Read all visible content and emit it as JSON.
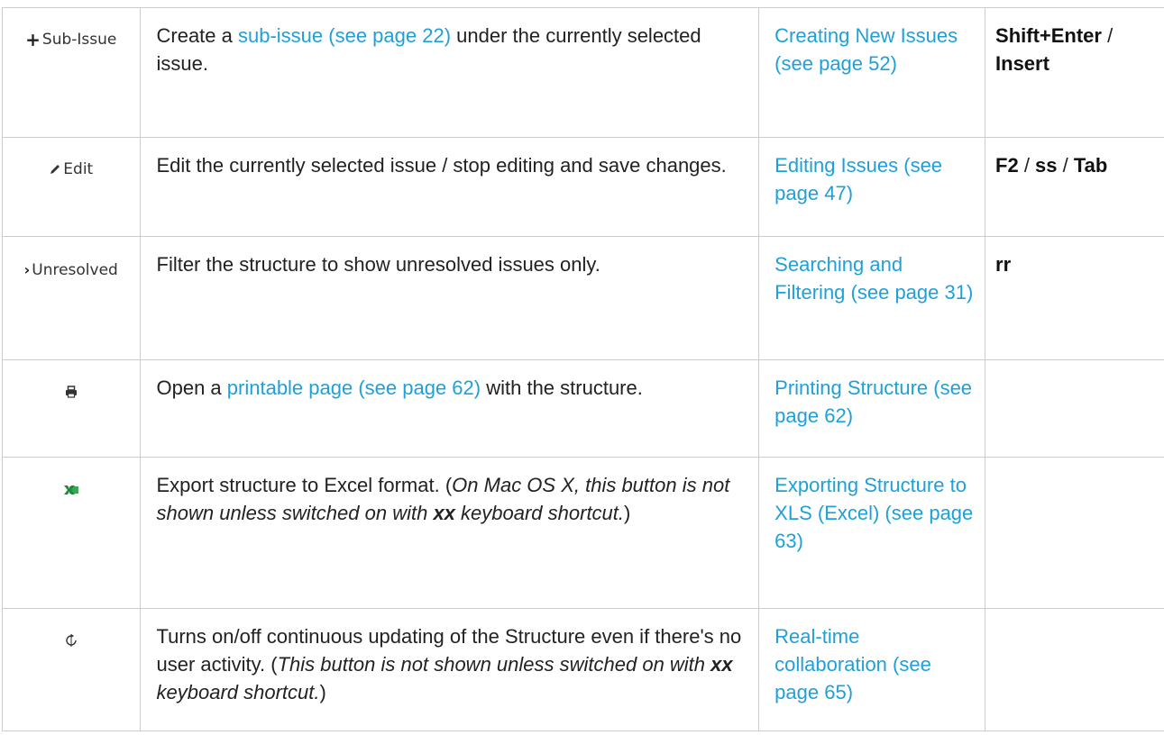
{
  "rows": [
    {
      "button": {
        "label": "Sub-Issue",
        "icon": "plus-icon"
      },
      "desc": {
        "pre": "Create a ",
        "link": "sub-issue (see page 22)",
        "post": " under the currently selected issue."
      },
      "ref": "Creating New Issues (see page 52)",
      "keys": {
        "k1": "Shift+Enter",
        "sep": " / ",
        "k2": "Insert"
      }
    },
    {
      "button": {
        "label": "Edit",
        "icon": "pencil-icon"
      },
      "desc": {
        "text": "Edit the currently selected issue / stop editing and save changes."
      },
      "ref": "Editing Issues (see page 47)",
      "keys": {
        "k1": "F2",
        "sep1": " / ",
        "k2": "ss",
        "sep2": " / ",
        "k3": "Tab"
      }
    },
    {
      "button": {
        "label": "Unresolved",
        "icon": "chevron-right-icon"
      },
      "desc": {
        "text": "Filter the structure to show unresolved issues only."
      },
      "ref": "Searching and Filtering (see page 31)",
      "keys": {
        "k1": "rr"
      }
    },
    {
      "button": {
        "icon": "printer-icon"
      },
      "desc": {
        "pre": "Open a ",
        "link": "printable page (see page 62)",
        "post": " with the structure."
      },
      "ref": "Printing Structure (see page 62)"
    },
    {
      "button": {
        "icon": "excel-icon"
      },
      "desc": {
        "pre": "Export structure to Excel format. (",
        "italic1": "On Mac OS X, this button is not shown unless switched on with ",
        "bold": "xx",
        "italic2": " keyboard shortcut.",
        "post": ")"
      },
      "ref": "Exporting Structure to XLS (Excel) (see page 63)"
    },
    {
      "button": {
        "icon": "refresh-toggle-icon"
      },
      "desc": {
        "pre": "Turns on/off continuous updating of the Structure even if there's no user activity. (",
        "italic1": "This button is not shown unless switched on with ",
        "bold": "xx",
        "italic2": " keyboard shortcut.",
        "post": ")"
      },
      "ref": "Real-time collaboration (see page 65)"
    }
  ],
  "colors": {
    "link": "#1fa0d8",
    "border": "#cccccc",
    "text": "#222222",
    "excel": "#1f8a3a"
  }
}
